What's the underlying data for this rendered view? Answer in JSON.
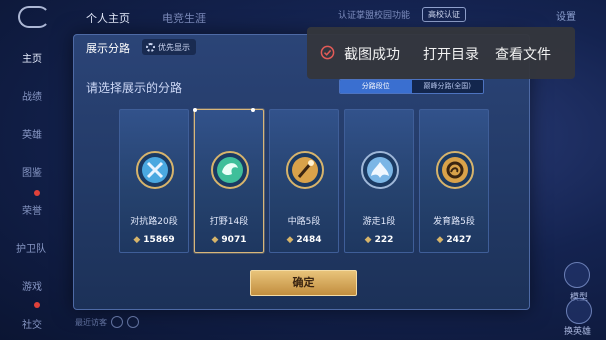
{
  "topbar": {
    "tab_profile": "个人主页",
    "tab_career": "电竞生涯",
    "verify_text": "认证掌盟校园功能",
    "school_badge": "高校认证",
    "settings": "设置"
  },
  "leftnav": {
    "items": [
      "主页",
      "战绩",
      "英雄",
      "图鉴",
      "荣誉",
      "护卫队",
      "游戏",
      "社交"
    ]
  },
  "right": {
    "label_1": "模型",
    "label_2": "换英雄"
  },
  "panel": {
    "title": "展示分路",
    "priority": "优先显示",
    "close": "✕",
    "subtitle": "请选择展示的分路",
    "seg_rank": "分路段位",
    "seg_peak": "巅峰分路(全国)",
    "confirm": "确定"
  },
  "cards": [
    {
      "label": "对抗路20段",
      "score": "15869",
      "color": "#4aa8e0",
      "symbol": "sword"
    },
    {
      "label": "打野14段",
      "score": "9071",
      "color": "#3fbf9a",
      "symbol": "dragon",
      "selected": true
    },
    {
      "label": "中路5段",
      "score": "2484",
      "color": "#d9a24a",
      "symbol": "staff"
    },
    {
      "label": "游走1段",
      "score": "222",
      "color": "#7bb6e6",
      "symbol": "wing"
    },
    {
      "label": "发育路5段",
      "score": "2427",
      "color": "#d9a24a",
      "symbol": "shield"
    }
  ],
  "chat": {
    "hint": "最近访客"
  },
  "toast": {
    "message": "截图成功",
    "open_dir": "打开目录",
    "view_file": "查看文件"
  },
  "colors": {
    "accent_gold": "#d8b67a",
    "toast_bg": "#34363c",
    "check_red": "#e35b57"
  }
}
